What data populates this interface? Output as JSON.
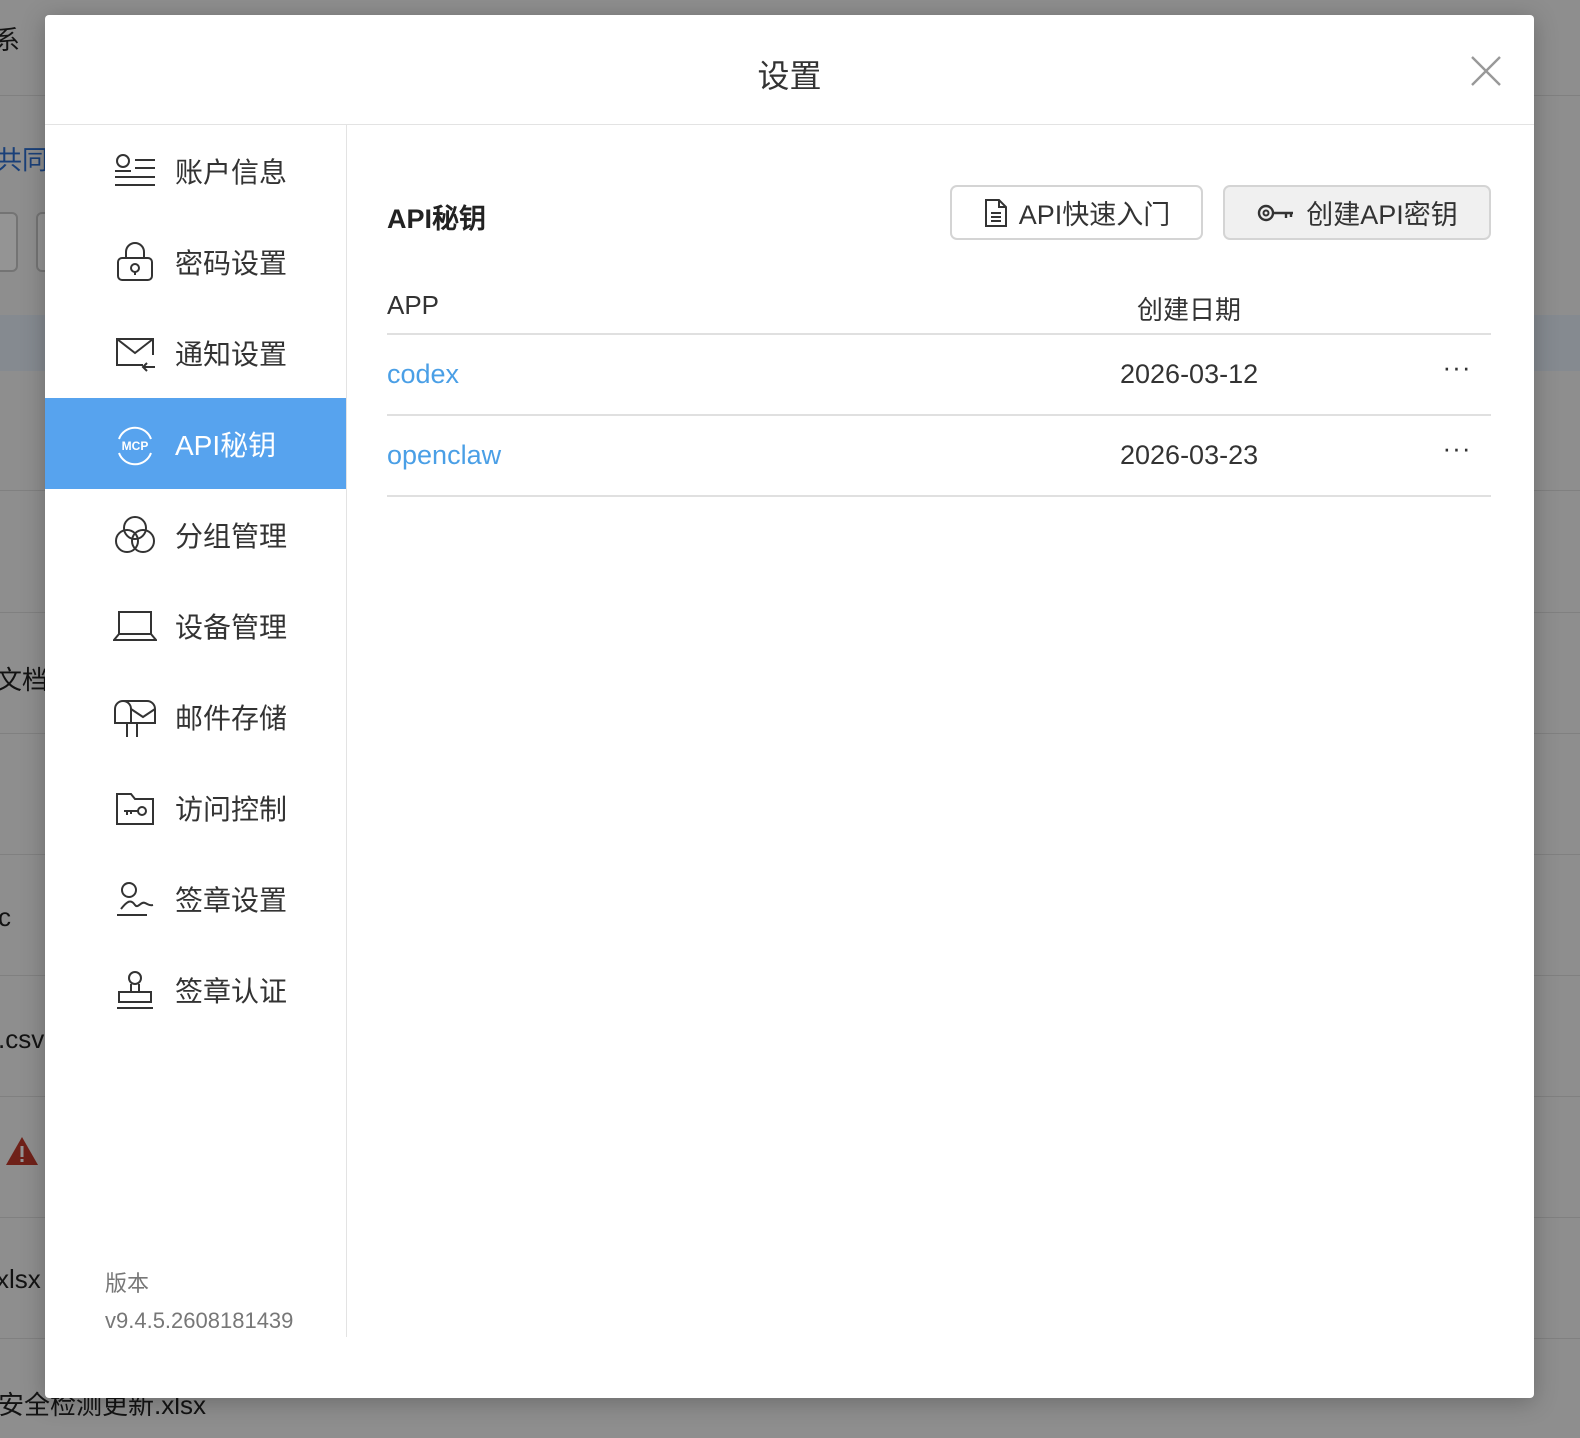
{
  "background": {
    "fragments": [
      "系",
      "共同",
      "文档.",
      "c",
      ".csv",
      "xlsx",
      "安全检测更新.xlsx"
    ]
  },
  "modal": {
    "title": "设置"
  },
  "sidebar": {
    "items": [
      {
        "label": "账户信息",
        "icon": "account-info-icon"
      },
      {
        "label": "密码设置",
        "icon": "lock-icon"
      },
      {
        "label": "通知设置",
        "icon": "mail-notify-icon"
      },
      {
        "label": "API秘钥",
        "icon": "mcp-icon",
        "active": true
      },
      {
        "label": "分组管理",
        "icon": "group-circles-icon"
      },
      {
        "label": "设备管理",
        "icon": "laptop-icon"
      },
      {
        "label": "邮件存储",
        "icon": "mailbox-icon"
      },
      {
        "label": "访问控制",
        "icon": "folder-key-icon"
      },
      {
        "label": "签章设置",
        "icon": "signature-icon"
      },
      {
        "label": "签章认证",
        "icon": "stamp-icon"
      }
    ],
    "version_label": "版本",
    "version_value": "v9.4.5.2608181439"
  },
  "content": {
    "title": "API秘钥",
    "doc_button": "API快速入门",
    "create_button": "创建API密钥",
    "table": {
      "col_app": "APP",
      "col_date": "创建日期",
      "rows": [
        {
          "app": "codex",
          "date": "2026-03-12",
          "more": "···"
        },
        {
          "app": "openclaw",
          "date": "2026-03-23",
          "more": "···"
        }
      ]
    }
  },
  "colors": {
    "accent": "#57a3ee",
    "link": "#4a9fe6"
  }
}
